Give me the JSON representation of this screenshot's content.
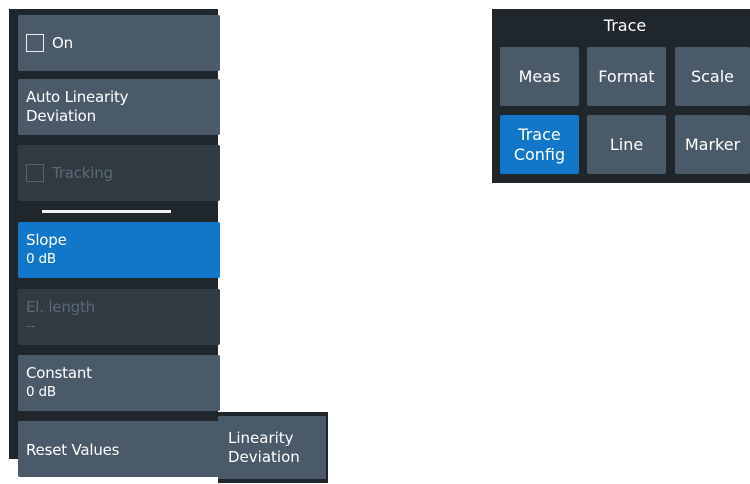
{
  "softkeys": {
    "on": {
      "label": "On"
    },
    "auto_linearity": {
      "line1": "Auto Linearity",
      "line2": "Deviation"
    },
    "tracking": {
      "label": "Tracking"
    },
    "slope": {
      "label": "Slope",
      "value": "0 dB"
    },
    "el_length": {
      "label": "El. length",
      "value": "--"
    },
    "constant": {
      "label": "Constant",
      "value": "0 dB"
    },
    "reset": {
      "label": "Reset Values"
    }
  },
  "side_tab": {
    "line1": "Linearity",
    "line2": "Deviation"
  },
  "trace_panel": {
    "title": "Trace",
    "buttons": [
      {
        "label": "Meas"
      },
      {
        "label": "Format"
      },
      {
        "label": "Scale"
      },
      {
        "line1": "Trace",
        "line2": "Config"
      },
      {
        "label": "Line"
      },
      {
        "label": "Marker"
      }
    ]
  },
  "colors": {
    "panel_bg": "#1f262c",
    "button_bg": "#4a5a68",
    "active_bg": "#1377c9",
    "disabled_text": "#5c6872"
  }
}
